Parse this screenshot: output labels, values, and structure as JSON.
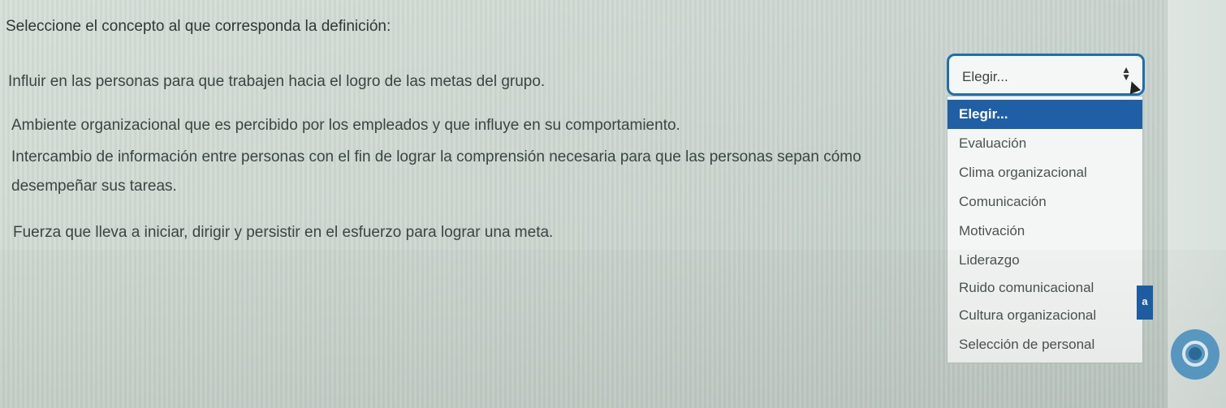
{
  "instruction": "Seleccione el concepto al que corresponda la definición:",
  "questions": [
    {
      "text": "Influir en las personas para que trabajen hacia el logro de las metas del grupo."
    },
    {
      "text": "Ambiente organizacional que es percibido por los empleados y que influye en su comportamiento."
    },
    {
      "text": "Intercambio de información entre personas con el fin de lograr la comprensión necesaria para que las personas sepan cómo desempeñar sus tareas."
    },
    {
      "text": "Fuerza que lleva a iniciar, dirigir y persistir en el esfuerzo para lograr una meta."
    }
  ],
  "select": {
    "value": "Elegir...",
    "arrow_icon": "up-down-arrows-icon",
    "options": [
      {
        "label": "Elegir...",
        "selected": true
      },
      {
        "label": "Evaluación"
      },
      {
        "label": "Clima organizacional"
      },
      {
        "label": "Comunicación"
      },
      {
        "label": "Motivación"
      },
      {
        "label": "Liderazgo"
      },
      {
        "label": "Ruido comunicacional"
      },
      {
        "label": "Cultura organizacional"
      },
      {
        "label": "Selección de personal"
      }
    ]
  },
  "side_badge": "a",
  "colors": {
    "accent": "#1f5fa6",
    "focus_border": "#1f6fb0"
  }
}
